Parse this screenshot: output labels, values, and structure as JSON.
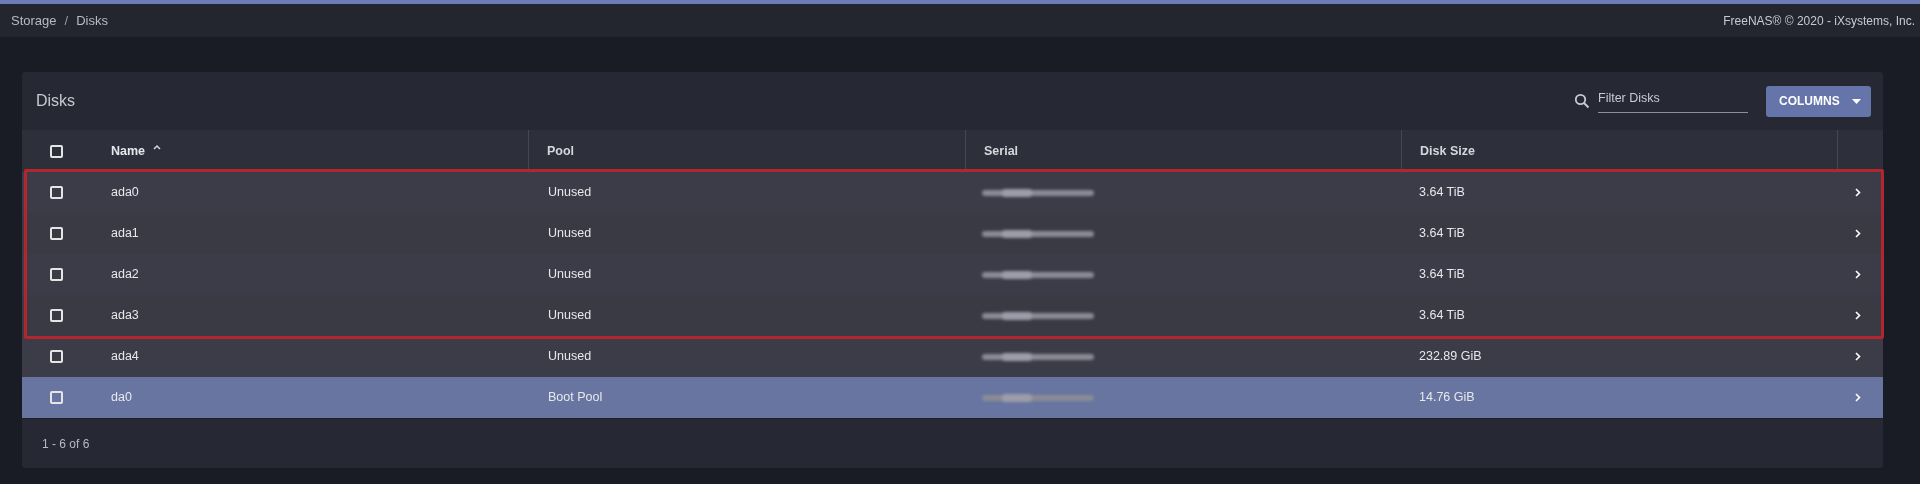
{
  "breadcrumb": {
    "items": [
      "Storage",
      "Disks"
    ],
    "separator": "/"
  },
  "copyright": "FreeNAS® © 2020 - iXsystems, Inc.",
  "card": {
    "title": "Disks",
    "filter": {
      "placeholder": "Filter Disks"
    },
    "columns_button": "COLUMNS"
  },
  "table": {
    "select_all": {
      "checked": false
    },
    "columns": [
      {
        "label": "Name",
        "sorted": true
      },
      {
        "label": "Pool",
        "sorted": false
      },
      {
        "label": "Serial",
        "sorted": false
      },
      {
        "label": "Disk Size",
        "sorted": false
      }
    ],
    "rows": [
      {
        "name": "ada0",
        "pool": "Unused",
        "size": "3.64 TiB",
        "checked": false,
        "selected": false,
        "highlighted": true
      },
      {
        "name": "ada1",
        "pool": "Unused",
        "size": "3.64 TiB",
        "checked": false,
        "selected": false,
        "highlighted": true
      },
      {
        "name": "ada2",
        "pool": "Unused",
        "size": "3.64 TiB",
        "checked": false,
        "selected": false,
        "highlighted": true
      },
      {
        "name": "ada3",
        "pool": "Unused",
        "size": "3.64 TiB",
        "checked": false,
        "selected": false,
        "highlighted": true
      },
      {
        "name": "ada4",
        "pool": "Unused",
        "size": "232.89 GiB",
        "checked": false,
        "selected": false,
        "highlighted": false
      },
      {
        "name": "da0",
        "pool": "Boot Pool",
        "size": "14.76 GiB",
        "checked": false,
        "selected": true,
        "highlighted": false
      }
    ]
  },
  "pagination": "1 - 6 of 6"
}
